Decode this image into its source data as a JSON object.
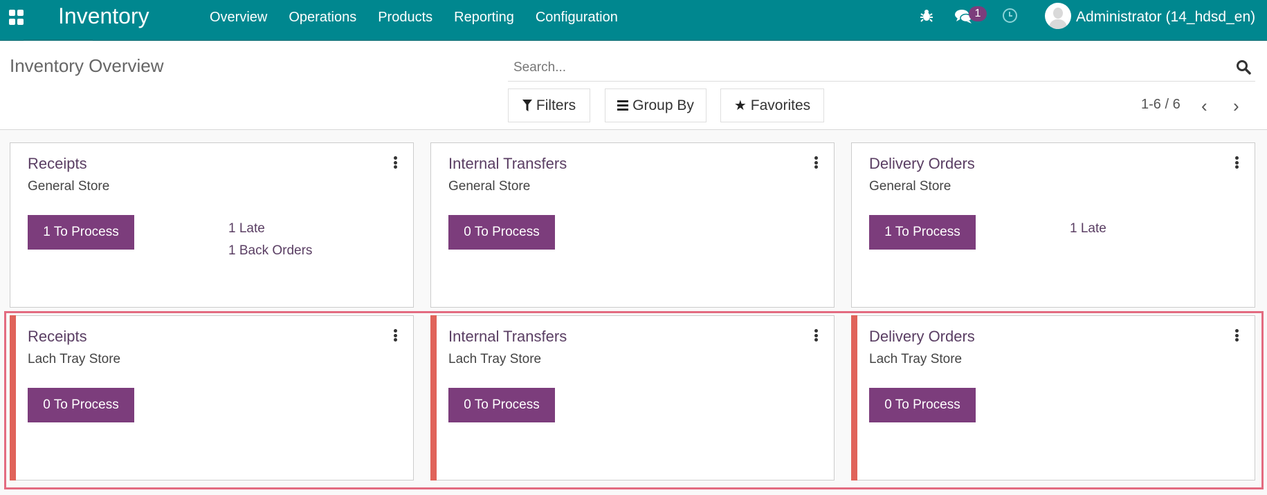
{
  "navbar": {
    "app_name": "Inventory",
    "menu": [
      "Overview",
      "Operations",
      "Products",
      "Reporting",
      "Configuration"
    ],
    "icons": {
      "apps": "apps-grid-icon",
      "debug": "bug-icon",
      "messages": "chat-icon",
      "activities": "clock-icon"
    },
    "message_count": "1",
    "user_name": "Administrator (14_hdsd_en)"
  },
  "control_panel": {
    "title": "Inventory Overview",
    "search_placeholder": "Search...",
    "filters_label": "Filters",
    "group_by_label": "Group By",
    "favorites_label": "Favorites",
    "pager": "1-6 / 6"
  },
  "colors": {
    "navbar": "#00878f",
    "primary": "#7c3d7c",
    "warning_stripe": "#e0635a",
    "highlight": "#e36b80"
  },
  "cards": [
    {
      "title": "Receipts",
      "warehouse": "General Store",
      "process_label": "1 To Process",
      "links": [
        "1 Late",
        "1 Back Orders"
      ]
    },
    {
      "title": "Internal Transfers",
      "warehouse": "General Store",
      "process_label": "0 To Process",
      "links": []
    },
    {
      "title": "Delivery Orders",
      "warehouse": "General Store",
      "process_label": "1 To Process",
      "links": [
        "1 Late"
      ]
    },
    {
      "title": "Receipts",
      "warehouse": "Lach Tray Store",
      "process_label": "0 To Process",
      "links": []
    },
    {
      "title": "Internal Transfers",
      "warehouse": "Lach Tray Store",
      "process_label": "0 To Process",
      "links": []
    },
    {
      "title": "Delivery Orders",
      "warehouse": "Lach Tray Store",
      "process_label": "0 To Process",
      "links": []
    }
  ]
}
